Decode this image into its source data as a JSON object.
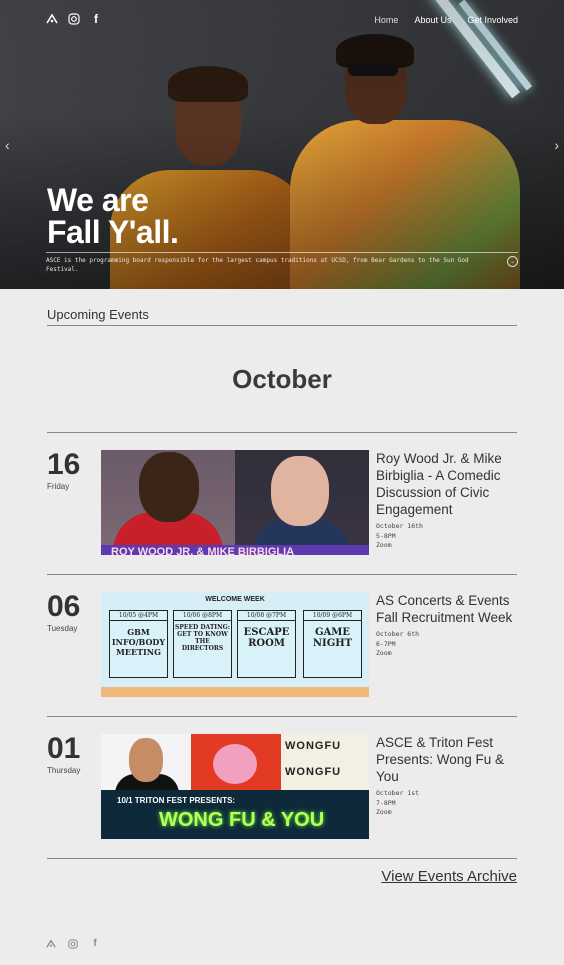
{
  "nav": {
    "links": [
      "Home",
      "About Us",
      "Get Involved"
    ],
    "icons": [
      "logo-icon",
      "instagram-icon",
      "facebook-icon"
    ]
  },
  "hero": {
    "title_line1": "We are",
    "title_line2": "Fall Y'all.",
    "description": "ASCE is the programming board responsible for the largest campus traditions at UCSD, from Bear Gardens to the Sun God Festival."
  },
  "upcoming": {
    "label": "Upcoming Events",
    "month": "October"
  },
  "events": [
    {
      "day": "16",
      "weekday": "Friday",
      "title": "Roy Wood Jr. & Mike Birbiglia - A Comedic Discussion of Civic Engagement",
      "date": "October 16th",
      "time": "5-8PM",
      "location": "Zoom",
      "image_text": "ROY WOOD JR. & MIKE BIRBIGLIA"
    },
    {
      "day": "06",
      "weekday": "Tuesday",
      "title": "AS Concerts & Events Fall Recruitment Week",
      "date": "October 6th",
      "time": "6-7PM",
      "location": "Zoom",
      "image_header": "WELCOME WEEK",
      "image_cards": [
        {
          "time": "10/05 @4PM",
          "label": "GBM INFO/BODY MEETING"
        },
        {
          "time": "10/06 @8PM",
          "label": "SPEED DATING: GET TO KNOW THE DIRECTORS"
        },
        {
          "time": "10/08 @7PM",
          "label": "ESCAPE ROOM"
        },
        {
          "time": "10/09 @6PM",
          "label": "GAME NIGHT"
        }
      ]
    },
    {
      "day": "01",
      "weekday": "Thursday",
      "title": "ASCE & Triton Fest Presents: Wong Fu & You",
      "date": "October 1st",
      "time": "7-8PM",
      "location": "Zoom",
      "image_line1": "10/1 TRITON FEST PRESENTS:",
      "image_line2": "WONG FU & YOU",
      "image_logo": "WONGFU"
    }
  ],
  "archive_link": "View Events Archive",
  "footer": {
    "icons": [
      "logo-icon",
      "instagram-icon",
      "facebook-icon"
    ]
  }
}
